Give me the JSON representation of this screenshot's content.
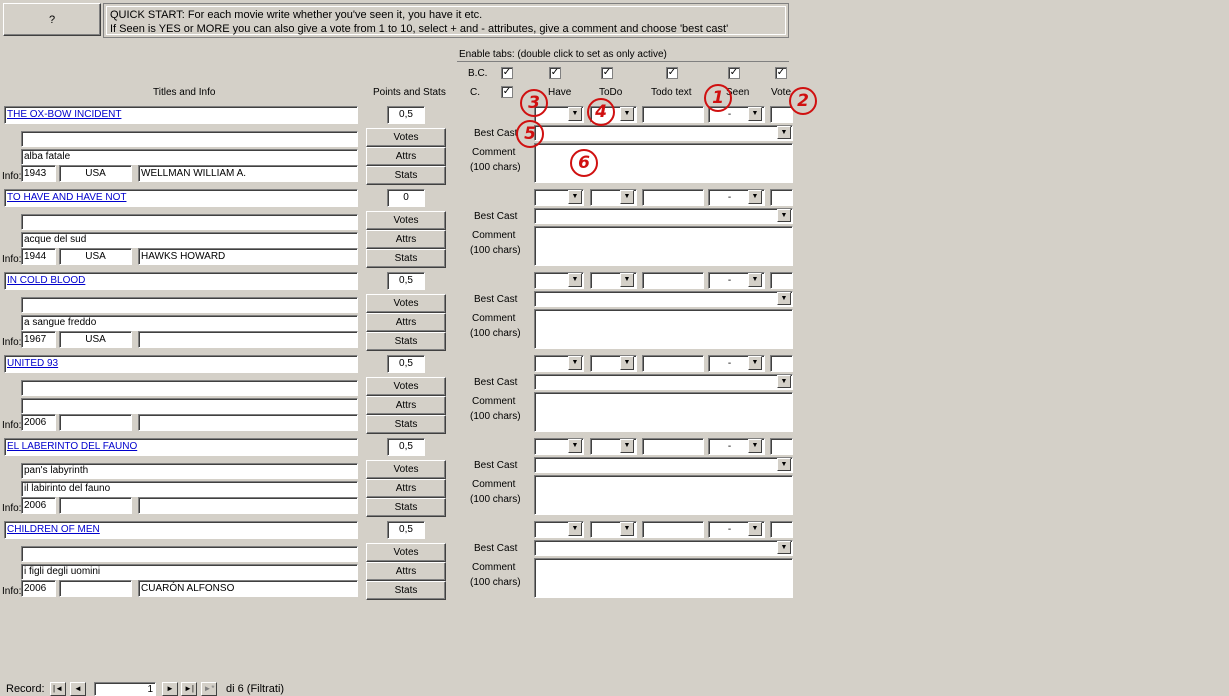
{
  "help_button": "?",
  "quick_start": {
    "line1": "QUICK START: For each movie write whether you've seen it, you have it etc.",
    "line2": "If Seen is YES or MORE you can also give a vote from 1 to 10, select + and - attributes, give a comment and choose 'best cast'"
  },
  "headers": {
    "titles_info": "Titles and Info",
    "points_stats": "Points and Stats",
    "enable_tabs": "Enable tabs: (double click to set as only active)",
    "bc": "B.C.",
    "c": "C.",
    "have": "Have",
    "todo": "ToDo",
    "todo_text": "Todo text",
    "seen": "Seen",
    "vote": "Vote"
  },
  "labels": {
    "info": "Info:",
    "votes": "Votes",
    "attrs": "Attrs",
    "stats": "Stats",
    "best_cast": "Best Cast",
    "comment": "Comment",
    "comment_limit": "(100 chars)",
    "seen_default": "-",
    "check_mark": "✓"
  },
  "annotations": [
    "1",
    "2",
    "3",
    "4",
    "5",
    "6"
  ],
  "movies": [
    {
      "title": "THE OX-BOW INCIDENT",
      "points": "0,5",
      "alt1": "",
      "alt2": "alba fatale",
      "year": "1943",
      "country": "USA",
      "director": "WELLMAN WILLIAM A."
    },
    {
      "title": "TO HAVE AND HAVE NOT",
      "points": "0",
      "alt1": "",
      "alt2": "acque del sud",
      "year": "1944",
      "country": "USA",
      "director": "HAWKS HOWARD"
    },
    {
      "title": "IN COLD BLOOD",
      "points": "0,5",
      "alt1": "",
      "alt2": "a sangue freddo",
      "year": "1967",
      "country": "USA",
      "director": ""
    },
    {
      "title": "UNITED 93",
      "points": "0,5",
      "alt1": "",
      "alt2": "",
      "year": "2006",
      "country": "",
      "director": ""
    },
    {
      "title": "EL LABERINTO DEL FAUNO",
      "points": "0,5",
      "alt1": "pan's labyrinth",
      "alt2": "il labirinto del fauno",
      "year": "2006",
      "country": "",
      "director": ""
    },
    {
      "title": "CHILDREN OF MEN",
      "points": "0,5",
      "alt1": "",
      "alt2": "i figli degli uomini",
      "year": "2006",
      "country": "",
      "director": "CUARÓN ALFONSO"
    }
  ],
  "nav": {
    "record_label": "Record:",
    "current": "1",
    "total": "di 6 (Filtrati)",
    "first": "|◄",
    "prev": "◄",
    "next": "►",
    "last": "►|",
    "new": "►*"
  }
}
